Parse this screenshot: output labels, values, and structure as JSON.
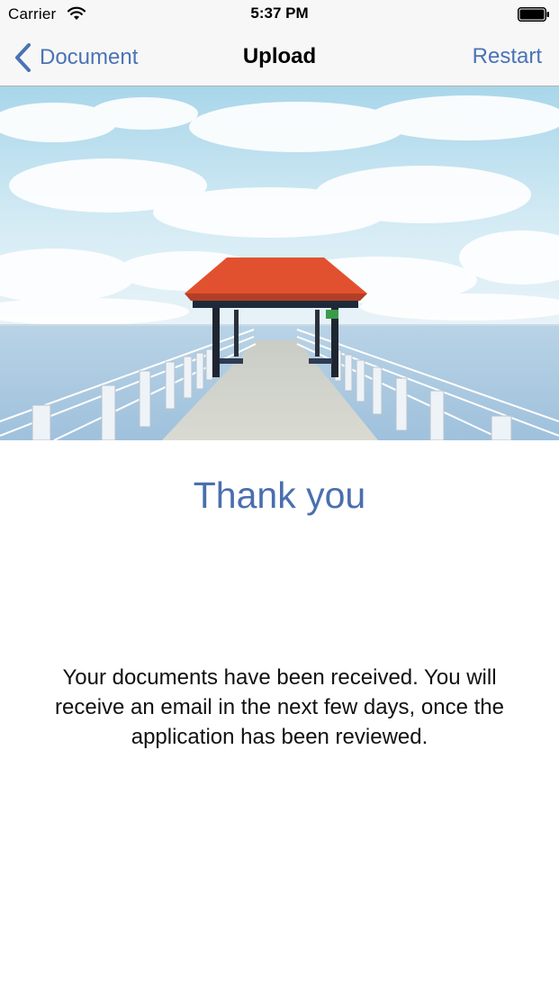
{
  "status_bar": {
    "carrier": "Carrier",
    "time": "5:37 PM"
  },
  "nav": {
    "back_label": "Document",
    "title": "Upload",
    "restart_label": "Restart"
  },
  "hero": {
    "icon": "pier-gazebo-photo"
  },
  "content": {
    "heading": "Thank you",
    "message": "Your documents have been received. You will receive an email in the next few days, once the application has been reviewed."
  },
  "colors": {
    "accent": "#4a73b5",
    "heading": "#4a6fae",
    "bar_background": "#f7f7f7"
  }
}
